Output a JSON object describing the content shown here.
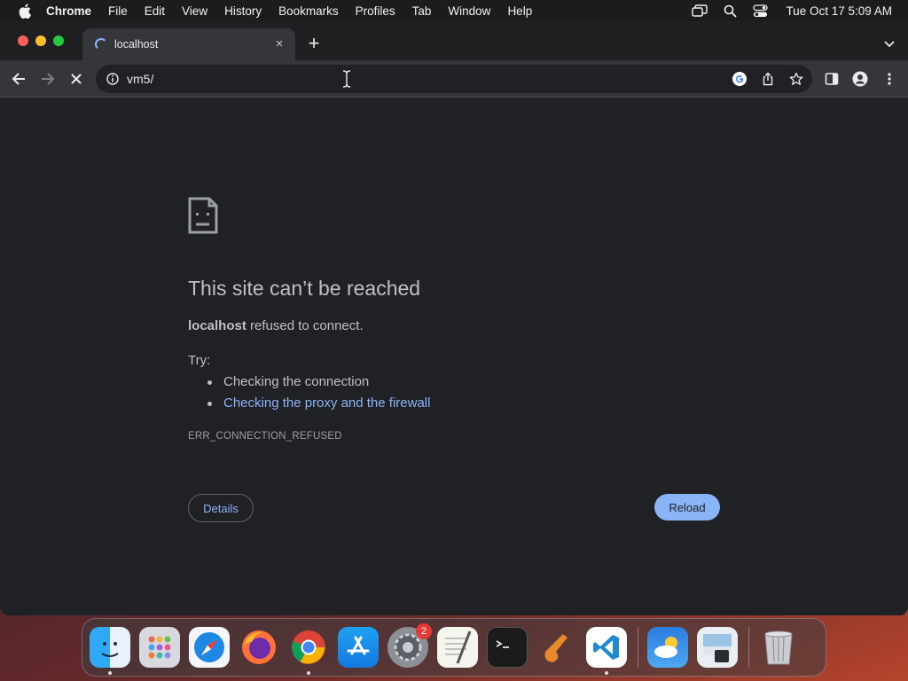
{
  "menubar": {
    "items": [
      "Chrome",
      "File",
      "Edit",
      "View",
      "History",
      "Bookmarks",
      "Profiles",
      "Tab",
      "Window",
      "Help"
    ],
    "clock": "Tue Oct 17  5:09 AM"
  },
  "tab": {
    "title": "localhost",
    "close": "×"
  },
  "newtab": "+",
  "omnibox": {
    "url": "vm5/"
  },
  "error": {
    "title": "This site can’t be reached",
    "host": "localhost",
    "message_rest": " refused to connect.",
    "try_label": "Try:",
    "suggestions": [
      "Checking the connection",
      "Checking the proxy and the firewall"
    ],
    "code": "ERR_CONNECTION_REFUSED",
    "details_label": "Details",
    "reload_label": "Reload"
  },
  "dock": {
    "apps": [
      "finder-icon",
      "launchpad-icon",
      "safari-icon",
      "firefox-icon",
      "chrome-icon",
      "app-store-icon",
      "system-settings-icon",
      "textedit-icon",
      "terminal-icon",
      "garageband-icon",
      "vscode-icon",
      "weather-icon",
      "preview-icon",
      "trash-icon"
    ],
    "settings_badge": "2"
  },
  "colors": {
    "accent": "#8ab4f8",
    "page_bg": "#202124",
    "toolbar_bg": "#35363a"
  }
}
